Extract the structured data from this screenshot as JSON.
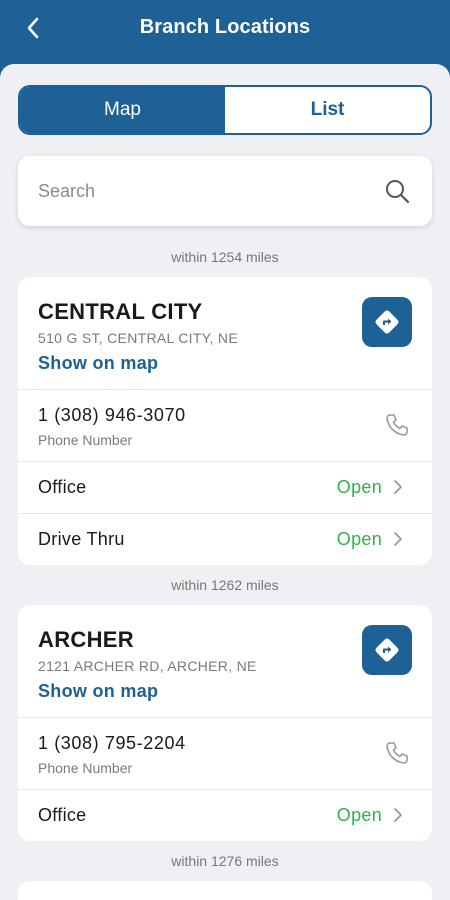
{
  "header": {
    "title": "Branch Locations"
  },
  "tabs": {
    "map": "Map",
    "list": "List"
  },
  "search": {
    "placeholder": "Search"
  },
  "colors": {
    "brand": "#1d6196",
    "open": "#2db34a"
  },
  "branches": [
    {
      "distance": "within 1254 miles",
      "name": "CENTRAL CITY",
      "address": "510 G ST, CENTRAL CITY, NE",
      "show_on_map": "Show on map",
      "phone": "1 (308) 946-3070",
      "phone_label": "Phone Number",
      "hours": [
        {
          "label": "Office",
          "status": "Open"
        },
        {
          "label": "Drive Thru",
          "status": "Open"
        }
      ]
    },
    {
      "distance": "within 1262 miles",
      "name": "ARCHER",
      "address": "2121 ARCHER RD, ARCHER, NE",
      "show_on_map": "Show on map",
      "phone": "1 (308) 795-2204",
      "phone_label": "Phone Number",
      "hours": [
        {
          "label": "Office",
          "status": "Open"
        }
      ]
    },
    {
      "distance": "within 1276 miles"
    }
  ]
}
